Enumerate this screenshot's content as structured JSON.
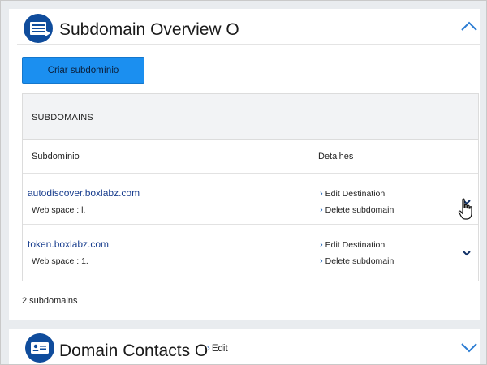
{
  "subdomain_section": {
    "title": "Subdomain Overview O",
    "create_button": "Criar subdomínio",
    "table": {
      "header": "SUBDOMAINS",
      "columns": [
        "Subdomínio",
        "Detalhes"
      ],
      "rows": [
        {
          "domain": "autodiscover.boxlabz.com",
          "web_space": "Web space : l.",
          "actions": [
            "Edit Destination",
            "Delete subdomain"
          ]
        },
        {
          "domain": "token.boxlabz.com",
          "web_space": "Web space : 1.",
          "actions": [
            "Edit Destination",
            "Delete subdomain"
          ]
        }
      ]
    },
    "count": "2 subdomains"
  },
  "contacts_section": {
    "title": "Domain Contacts O",
    "edit_label": "Edit"
  },
  "icons": {
    "section_icon": "list-card-icon",
    "contacts_icon": "contact-card-icon",
    "collapse": "chevron-up-icon",
    "expand": "chevron-down-icon",
    "link_arrow": "chevron-right-icon",
    "cursor": "hand-pointer-icon"
  },
  "colors": {
    "accent": "#1b8ff0",
    "icon_bg": "#0f4c9c",
    "link": "#1a3f8f",
    "chevron": "#2b7cd3"
  }
}
